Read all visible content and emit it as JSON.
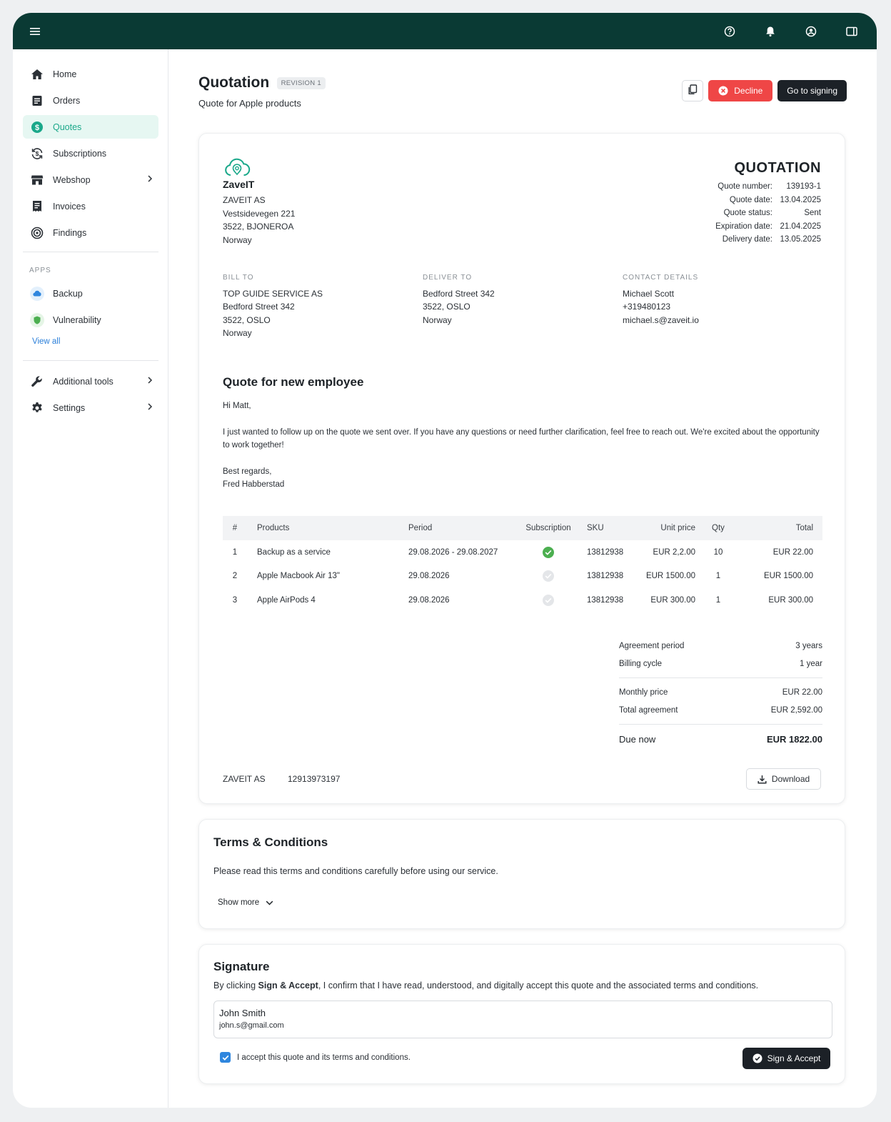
{
  "colors": {
    "topbar": "#0a3a34",
    "accent": "#1aa88a",
    "decline": "#ef4646",
    "dark_button": "#1c2127",
    "link": "#2b7fd9",
    "success": "#4caf50"
  },
  "topbar": {
    "icons": [
      "menu-icon",
      "help-icon",
      "bell-icon",
      "account-icon",
      "panel-icon"
    ]
  },
  "sidebar": {
    "items": [
      {
        "label": "Home",
        "icon": "home-icon"
      },
      {
        "label": "Orders",
        "icon": "orders-icon"
      },
      {
        "label": "Quotes",
        "icon": "dollar-icon",
        "active": true
      },
      {
        "label": "Subscriptions",
        "icon": "subscriptions-icon"
      },
      {
        "label": "Webshop",
        "icon": "store-icon",
        "has_submenu": true
      },
      {
        "label": "Invoices",
        "icon": "invoice-icon"
      },
      {
        "label": "Findings",
        "icon": "target-icon"
      }
    ],
    "apps_title": "APPS",
    "apps": [
      {
        "label": "Backup",
        "icon": "cloud-icon"
      },
      {
        "label": "Vulnerability",
        "icon": "shield-icon"
      }
    ],
    "view_all": "View all",
    "bottom_items": [
      {
        "label": "Additional tools",
        "icon": "wrench-icon",
        "has_submenu": true
      },
      {
        "label": "Settings",
        "icon": "gear-icon",
        "has_submenu": true
      }
    ]
  },
  "page": {
    "title": "Quotation",
    "revision": "REVISION 1",
    "subtitle": "Quote for Apple products",
    "decline_label": "Decline",
    "signing_label": "Go to signing"
  },
  "quote": {
    "logo_text": "ZaveIT",
    "company": [
      "ZAVEIT AS",
      "Vestsidevegen 221",
      "3522, BJONEROA",
      "Norway"
    ],
    "heading": "QUOTATION",
    "meta": [
      {
        "k": "Quote number:",
        "v": "139193-1"
      },
      {
        "k": "Quote date:",
        "v": "13.04.2025"
      },
      {
        "k": "Quote status:",
        "v": "Sent"
      },
      {
        "k": "Expiration date:",
        "v": "21.04.2025"
      },
      {
        "k": "Delivery date:",
        "v": "13.05.2025"
      }
    ],
    "bill_to": {
      "label": "BILL TO",
      "lines": [
        "TOP GUIDE SERVICE AS",
        "Bedford Street 342",
        "3522, OSLO",
        "Norway"
      ]
    },
    "deliver_to": {
      "label": "DELIVER TO",
      "lines": [
        "Bedford Street 342",
        "3522, OSLO",
        "Norway"
      ]
    },
    "contact": {
      "label": "CONTACT DETAILS",
      "lines": [
        "Michael Scott",
        "+319480123",
        "michael.s@zaveit.io"
      ]
    },
    "message": {
      "title": "Quote for new employee",
      "greeting": "Hi Matt,",
      "body": "I just wanted to follow up on the quote we sent over. If you have any questions or need further clarification, feel free to reach out. We're excited about the opportunity to work together!",
      "closing": "Best regards,",
      "signature": "Fred Habberstad"
    },
    "table": {
      "headers": [
        "#",
        "Products",
        "Period",
        "Subscription",
        "SKU",
        "Unit price",
        "Qty",
        "Total"
      ],
      "rows": [
        {
          "num": "1",
          "product": "Backup as a service",
          "period": "29.08.2026 - 29.08.2027",
          "subscription": true,
          "sku": "13812938",
          "unit": "EUR 2,2.00",
          "qty": "10",
          "total": "EUR 22.00"
        },
        {
          "num": "2",
          "product": "Apple Macbook Air 13\"",
          "period": "29.08.2026",
          "subscription": false,
          "sku": "13812938",
          "unit": "EUR 1500.00",
          "qty": "1",
          "total": "EUR 1500.00"
        },
        {
          "num": "3",
          "product": "Apple AirPods 4",
          "period": "29.08.2026",
          "subscription": false,
          "sku": "13812938",
          "unit": "EUR 300.00",
          "qty": "1",
          "total": "EUR 300.00"
        }
      ]
    },
    "summary": {
      "agreement_period": {
        "k": "Agreement period",
        "v": "3 years"
      },
      "billing_cycle": {
        "k": "Billing cycle",
        "v": "1 year"
      },
      "monthly_price": {
        "k": "Monthly price",
        "v": "EUR 22.00"
      },
      "total_agreement": {
        "k": "Total agreement",
        "v": "EUR 2,592.00"
      },
      "due_now": {
        "k": "Due now",
        "v": "EUR 1822.00"
      }
    },
    "footer": {
      "org": "ZAVEIT AS",
      "org_number": "12913973197",
      "download_label": "Download"
    }
  },
  "terms": {
    "title": "Terms & Conditions",
    "text": "Please read this terms and conditions carefully before using our service.",
    "show_more": "Show more"
  },
  "signature": {
    "title": "Signature",
    "text_prefix": "By clicking ",
    "text_bold": "Sign & Accept",
    "text_suffix": ", I confirm that I have read, understood, and digitally accept this quote and the associated terms and conditions.",
    "name": "John Smith",
    "email": "john.s@gmail.com",
    "checkbox_label": "I accept this quote and its terms and conditions.",
    "checkbox_checked": true,
    "button_label": "Sign & Accept"
  }
}
